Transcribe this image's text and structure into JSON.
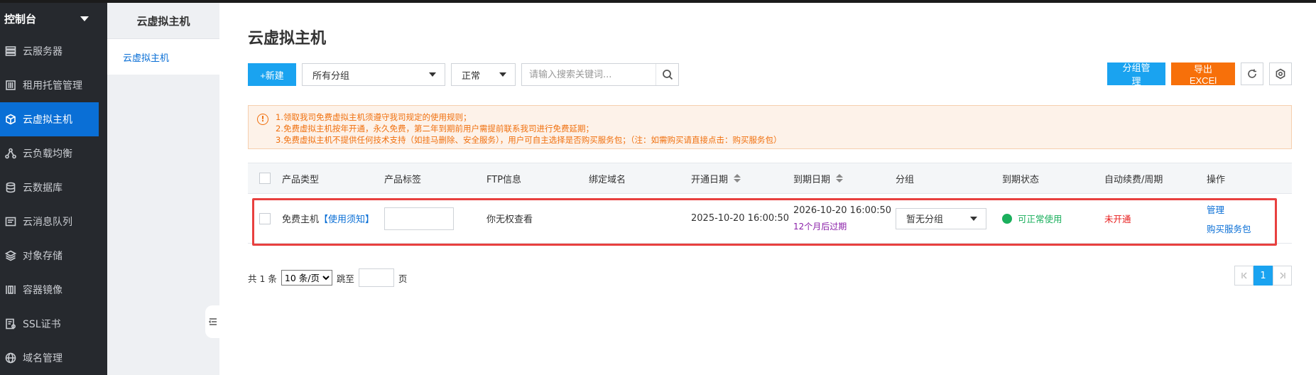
{
  "sidebar": {
    "header": "控制台",
    "items": [
      {
        "label": "云服务器",
        "icon": "server-icon"
      },
      {
        "label": "租用托管管理",
        "icon": "rack-icon"
      },
      {
        "label": "云虚拟主机",
        "icon": "cube-icon",
        "active": true
      },
      {
        "label": "云负载均衡",
        "icon": "loadbalancer-icon"
      },
      {
        "label": "云数据库",
        "icon": "database-icon"
      },
      {
        "label": "云消息队列",
        "icon": "queue-icon"
      },
      {
        "label": "对象存储",
        "icon": "storage-icon"
      },
      {
        "label": "容器镜像",
        "icon": "container-icon"
      },
      {
        "label": "SSL证书",
        "icon": "certificate-icon"
      },
      {
        "label": "域名管理",
        "icon": "globe-icon"
      }
    ]
  },
  "subnav": {
    "title": "云虚拟主机",
    "item": "云虚拟主机"
  },
  "page": {
    "title": "云虚拟主机"
  },
  "toolbar": {
    "new_label": "+新建",
    "group_select": "所有分组",
    "status_select": "正常",
    "search_placeholder": "请输入搜索关键词...",
    "group_manage_label": "分组管理",
    "export_label": "导出EXCEl"
  },
  "notice": {
    "lines": [
      "1.领取我司免费虚拟主机须遵守我司规定的使用规则；",
      "2.免费虚拟主机按年开通，永久免费，第二年到期前用户需提前联系我司进行免费延期；",
      "3.免费虚拟主机不提供任何技术支持（如挂马删除、安全服务），用户可自主选择是否购买服务包；（注：如需购买请直接点击：购买服务包）"
    ]
  },
  "table": {
    "headers": [
      "产品类型",
      "产品标签",
      "FTP信息",
      "绑定域名",
      "开通日期",
      "到期日期",
      "分组",
      "到期状态",
      "自动续费/周期",
      "操作"
    ],
    "rows": [
      {
        "type": "免费主机",
        "type_link": "【使用须知】",
        "ftp": "你无权查看",
        "domain": "",
        "open_date": "2025-10-20 16:00:50",
        "expire_date": "2026-10-20 16:00:50",
        "expire_note": "12个月后过期",
        "group": "暂无分组",
        "status": "可正常使用",
        "auto_renew": "未开通",
        "op_manage": "管理",
        "op_buy": "购买服务包"
      }
    ]
  },
  "pager": {
    "total_prefix": "共 1 条",
    "page_size": "10 条/页",
    "jump_label": "跳至",
    "page_suffix": "页",
    "current": "1"
  },
  "colors": {
    "primary": "#1aa3f0",
    "orange": "#f7700a",
    "active_nav": "#0a6fd6",
    "success": "#1aaf5c",
    "danger": "#e81d1d"
  }
}
